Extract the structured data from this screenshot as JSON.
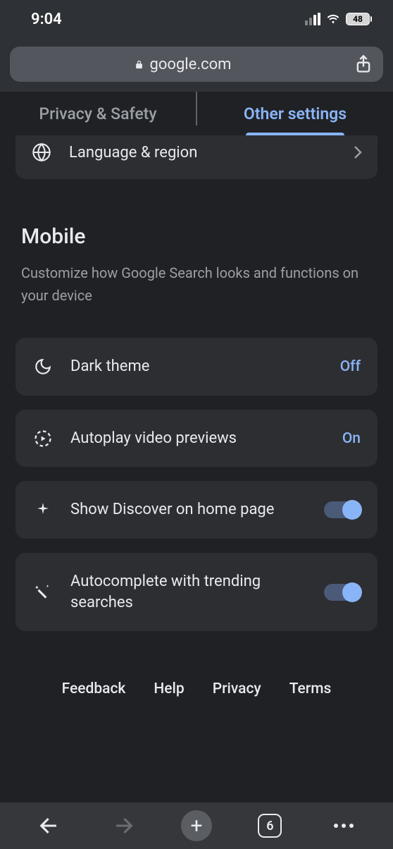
{
  "status": {
    "time": "9:04",
    "battery": "48"
  },
  "address": {
    "domain": "google.com"
  },
  "tabs": {
    "privacy": "Privacy & Safety",
    "other": "Other settings"
  },
  "lang_row": {
    "label": "Language & region"
  },
  "section": {
    "title": "Mobile",
    "desc": "Customize how Google Search looks and functions on your device"
  },
  "settings": {
    "dark_theme": {
      "label": "Dark theme",
      "value": "Off"
    },
    "autoplay": {
      "label": "Autoplay video previews",
      "value": "On"
    },
    "discover": {
      "label": "Show Discover on home page"
    },
    "autocomplete": {
      "label": "Autocomplete with trending searches"
    }
  },
  "footer": {
    "feedback": "Feedback",
    "help": "Help",
    "privacy": "Privacy",
    "terms": "Terms"
  },
  "bottomnav": {
    "tab_count": "6"
  }
}
